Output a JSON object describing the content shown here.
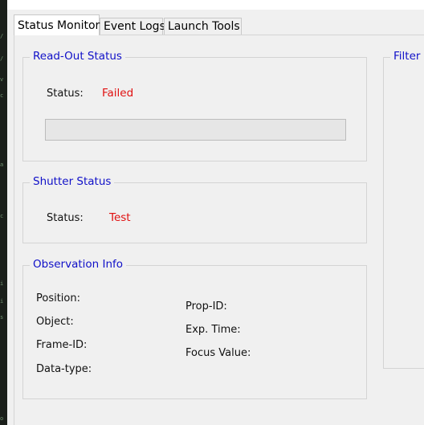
{
  "tabs": [
    {
      "label": "Status Monitor",
      "active": true
    },
    {
      "label": "Event Logs",
      "active": false
    },
    {
      "label": "Launch Tools",
      "active": false
    }
  ],
  "readout": {
    "title": "Read-Out Status",
    "status_label": "Status:",
    "status_value": "Failed",
    "progress": 0
  },
  "shutter": {
    "title": "Shutter Status",
    "status_label": "Status:",
    "status_value": "Test"
  },
  "observation": {
    "title": "Observation Info",
    "left_labels": [
      "Position:",
      "Object:",
      "Frame-ID:",
      "Data-type:"
    ],
    "right_labels": [
      "Prop-ID:",
      "Exp. Time:",
      "Focus Value:"
    ]
  },
  "filter": {
    "title": "Filter S"
  },
  "colors": {
    "group_title": "#1010c8",
    "status_value": "#e01010",
    "panel_bg": "#f0f0f0"
  }
}
